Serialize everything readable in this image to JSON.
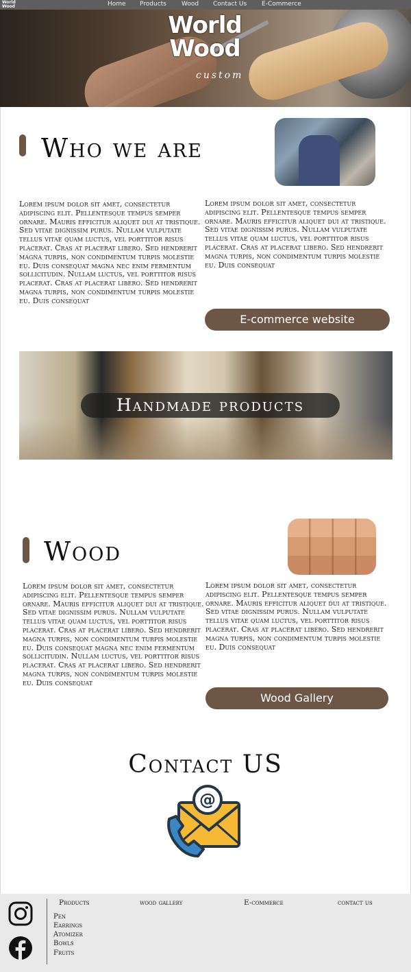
{
  "nav": {
    "logo_line1": "World",
    "logo_line2": "Wood",
    "items": [
      "Home",
      "Products",
      "Wood",
      "Contact Us",
      "E-Commerce"
    ]
  },
  "hero": {
    "logo_line1": "World",
    "logo_line2": "Wood",
    "logo_sub": "custom"
  },
  "who": {
    "title": "Who we are",
    "col1": "Lorem ipsum dolor sit amet, consectetur adipiscing elit. Pellentesque tempus semper ornare. Mauris efficitur aliquet dui at tristique. Sed vitae dignissim purus. Nullam vulputate tellus vitae quam luctus, vel porttitor risus placerat. Cras at placerat libero. Sed hendrerit magna turpis, non condimentum turpis molestie eu. Duis consequat magna nec enim fermentum sollicitudin. Nullam luctus, vel porttitor risus placerat. Cras at placerat libero. Sed hendrerit magna turpis, non condimentum turpis molestie eu. Duis consequat",
    "col2": "Lorem ipsum dolor sit amet, consectetur adipiscing elit. Pellentesque tempus semper ornare. Mauris efficitur aliquet dui at tristique. Sed vitae dignissim purus. Nullam vulputate tellus vitae quam luctus, vel porttitor risus placerat. Cras at placerat libero. Sed hendrerit magna turpis, non condimentum turpis molestie eu. Duis consequat",
    "button": "E-commerce website"
  },
  "banner": {
    "label": "Handmade products"
  },
  "wood": {
    "title": "Wood",
    "col1": "Lorem ipsum dolor sit amet, consectetur adipiscing elit. Pellentesque tempus semper ornare. Mauris efficitur aliquet dui at tristique. Sed vitae dignissim purus. Nullam vulputate tellus vitae quam luctus, vel porttitor risus placerat. Cras at placerat libero. Sed hendrerit magna turpis, non condimentum turpis molestie eu. Duis consequat magna nec enim fermentum sollicitudin. Nullam luctus, vel porttitor risus placerat. Cras at placerat libero. Sed hendrerit magna turpis, non condimentum turpis molestie eu. Duis consequat",
    "col2": "Lorem ipsum dolor sit amet, consectetur adipiscing elit. Pellentesque tempus semper ornare. Mauris efficitur aliquet dui at tristique. Sed vitae dignissim purus. Nullam vulputate tellus vitae quam luctus, vel porttitor risus placerat. Cras at placerat libero. Sed hendrerit magna turpis, non condimentum turpis molestie eu. Duis consequat",
    "button": "Wood Gallery"
  },
  "contact": {
    "title": "Contact US"
  },
  "footer": {
    "headings": [
      "Products",
      "wood gallery",
      "E-commerce",
      "contact us"
    ],
    "products": [
      "Pen",
      "Earrings",
      "Atomizer",
      "Bowls",
      "Fruits"
    ]
  },
  "colors": {
    "accent": "#6e5646",
    "nav_bg": "#5e5e5e",
    "footer_bg": "#e9e9e9"
  }
}
